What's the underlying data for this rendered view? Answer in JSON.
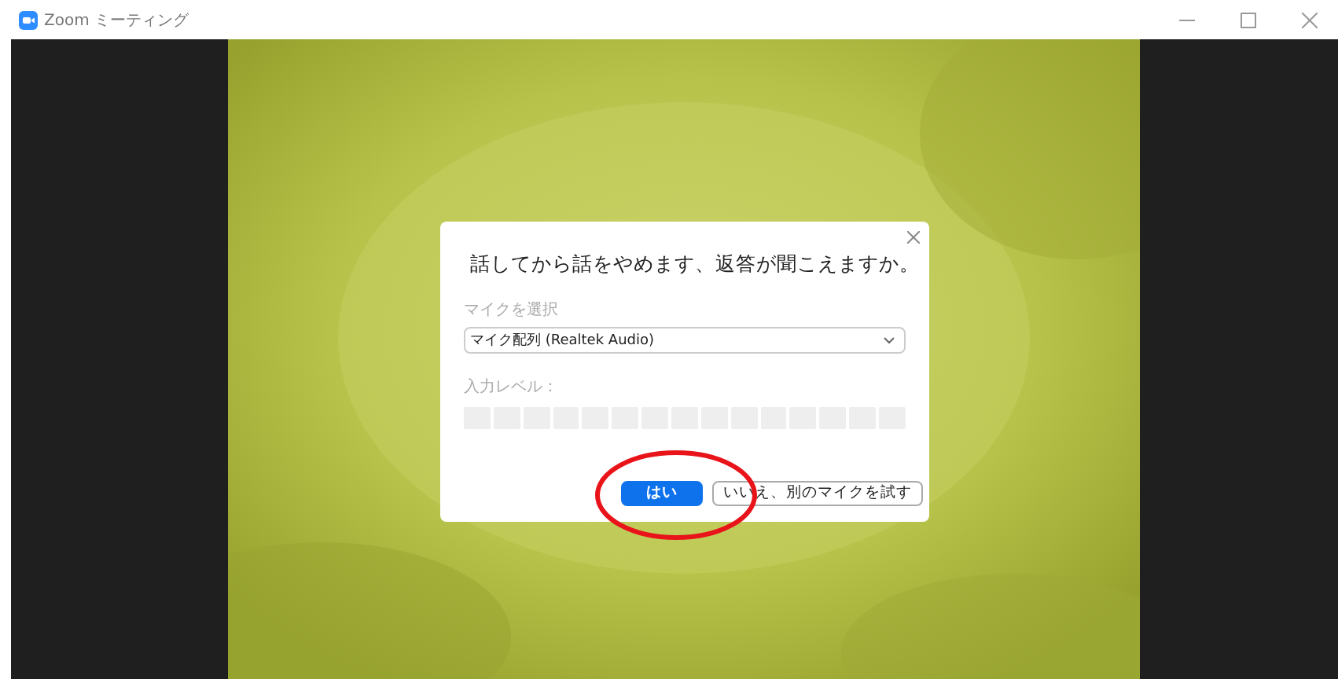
{
  "window": {
    "title": "Zoom ミーティング"
  },
  "dialog": {
    "title": "話してから話をやめます、返答が聞こえますか。",
    "mic_label": "マイクを選択",
    "mic_value": "マイク配列 (Realtek Audio)",
    "level_label": "入力レベル：",
    "buttons": [
      {
        "label": "はい",
        "kind": "primary"
      },
      {
        "label": "いいえ、別のマイクを試す",
        "kind": "secondary"
      }
    ]
  }
}
